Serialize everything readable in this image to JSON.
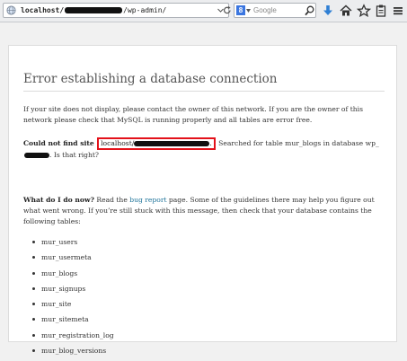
{
  "browser": {
    "url_prefix": "localhost/",
    "url_suffix": "/wp-admin/",
    "search_engine_badge": "8",
    "search_placeholder": "Google",
    "icons": [
      "globe-icon",
      "dropdown-arrow-icon",
      "reload-icon",
      "search-icon",
      "download-icon",
      "home-icon",
      "bookmark-star-icon",
      "clipboard-icon",
      "menu-icon"
    ]
  },
  "page": {
    "title": "Error establishing a database connection",
    "intro": "If your site does not display, please contact the owner of this network. If you are the owner of this network please check that MySQL is running properly and all tables are error free.",
    "could_not_find_label": "Could not find site",
    "host_prefix": "localhost/",
    "host_suffix": ".",
    "searched_for_a": "Searched for table mur_blogs in database",
    "db_prefix": "wp_",
    "searched_for_b": ". Is that right?",
    "what_label": "What do I do now?",
    "read_the": "Read the",
    "bug_report_link": "bug report",
    "guidelines_text": "page. Some of the guidelines there may help you figure out what went wrong. If you’re still stuck with this message, then check that your database contains the following tables:",
    "tables": [
      "mur_users",
      "mur_usermeta",
      "mur_blogs",
      "mur_signups",
      "mur_site",
      "mur_sitemeta",
      "mur_registration_log",
      "mur_blog_versions"
    ]
  },
  "colors": {
    "highlight_border": "#e3111a",
    "link": "#21759b",
    "page_background": "#f1f1f1"
  }
}
